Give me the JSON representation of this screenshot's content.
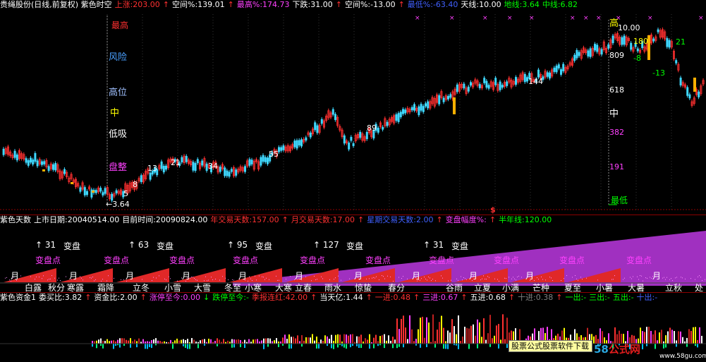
{
  "main_header": {
    "title": "贵绳股份(日线,前复权) 紫色时空",
    "items": [
      {
        "text": "上涨:203.00",
        "color": "#ff3030"
      },
      {
        "text": "↑",
        "color": "#ff3030"
      },
      {
        "text": "空间%:139.01",
        "color": "#ffffff"
      },
      {
        "text": "↑",
        "color": "#ff3030"
      },
      {
        "text": "最高%:174.73",
        "color": "#ff40ff"
      },
      {
        "text": "下跌:31.00",
        "color": "#ffffff"
      },
      {
        "text": "↑",
        "color": "#ff3030"
      },
      {
        "text": "空间%:-13.00",
        "color": "#ffffff"
      },
      {
        "text": "↑",
        "color": "#ff3030"
      },
      {
        "text": "最低%:-63.40",
        "color": "#4060ff"
      },
      {
        "text": "天线:10.00",
        "color": "#ffffff"
      },
      {
        "text": "地线:3.64",
        "color": "#00ff00"
      },
      {
        "text": "中线:6.82",
        "color": "#00ff00"
      }
    ]
  },
  "left_scale": [
    {
      "text": "最高",
      "color": "#ff3030"
    },
    {
      "text": "风险",
      "color": "#4aa0ff"
    },
    {
      "text": "高位",
      "color": "#a0c0ff"
    },
    {
      "text": "中",
      "color": "#ffff00"
    },
    {
      "text": "低吸",
      "color": "#ffffff"
    },
    {
      "text": "盘整",
      "color": "#ff40ff"
    }
  ],
  "right_scale": [
    {
      "text": "高",
      "color": "#ffff00"
    },
    {
      "text": "10.00",
      "color": "#ffffff"
    },
    {
      "text": "809",
      "color": "#ffffff"
    },
    {
      "text": "618",
      "color": "#ffffff"
    },
    {
      "text": "中",
      "color": "#ffffff"
    },
    {
      "text": "382",
      "color": "#ff40ff"
    },
    {
      "text": "191",
      "color": "#ff40ff"
    },
    {
      "text": "最低",
      "color": "#00ff00"
    }
  ],
  "fib_labels": [
    {
      "text": "5"
    },
    {
      "text": "8"
    },
    {
      "text": "13"
    },
    {
      "text": "21"
    },
    {
      "text": "34"
    },
    {
      "text": "55"
    },
    {
      "text": "89"
    },
    {
      "text": "144"
    },
    {
      "text": "180"
    },
    {
      "text": "-8"
    },
    {
      "text": "21"
    },
    {
      "text": "-13"
    }
  ],
  "low_label": "3.64",
  "dollar_mark": "$",
  "mid_header": {
    "title": "紫色天数",
    "items": [
      {
        "text": "上市日期:20040514.00",
        "color": "#ffffff"
      },
      {
        "text": "目前时间:20090824.00",
        "color": "#ffffff"
      },
      {
        "text": "年交易天数:157.00",
        "color": "#ff3030"
      },
      {
        "text": "↑",
        "color": "#ff3030"
      },
      {
        "text": "月交易天数:17.00",
        "color": "#ff3030"
      },
      {
        "text": "↑",
        "color": "#ff3030"
      },
      {
        "text": "星期交易天数:2.00",
        "color": "#4060ff"
      },
      {
        "text": "↑",
        "color": "#ff3030"
      },
      {
        "text": "变盘幅度%:",
        "color": "#ff40ff"
      },
      {
        "text": "↑",
        "color": "#ff3030"
      },
      {
        "text": "半年线:120.00",
        "color": "#00ff00"
      }
    ]
  },
  "count_labels": [
    {
      "arrow": "↑",
      "num": "31",
      "word": "变盘"
    },
    {
      "arrow": "↑",
      "num": "63",
      "word": "变盘"
    },
    {
      "arrow": "↑",
      "num": "95",
      "word": "变盘"
    },
    {
      "arrow": "↑",
      "num": "127",
      "word": "变盘"
    },
    {
      "arrow": "↑",
      "num": "31",
      "word": "变盘"
    }
  ],
  "change_points": [
    "变盘点",
    "变盘点",
    "变盘点",
    "变盘点",
    "变盘点",
    "变盘点",
    "变盘点",
    "变盘点",
    "变盘点",
    "变盘点"
  ],
  "month_labels": [
    "月",
    "月",
    "月",
    "月",
    "月",
    "月",
    "月",
    "月",
    "月",
    "月",
    "月"
  ],
  "solar_terms": [
    "白露",
    "秋分",
    "寒露",
    "霜降",
    "立冬",
    "小雪",
    "大雪",
    "冬至",
    "小寒",
    "大寒",
    "立春",
    "雨水",
    "惊蛰",
    "春分",
    "谷雨",
    "立夏",
    "小满",
    "芒种",
    "夏至",
    "小暑",
    "大暑",
    "立秋",
    "处"
  ],
  "bot_header": {
    "title": "紫色资金1",
    "items": [
      {
        "text": "委买比:3.82",
        "color": "#ffffff"
      },
      {
        "text": "↑",
        "color": "#ff3030"
      },
      {
        "text": "资金比:2.00",
        "color": "#ffffff"
      },
      {
        "text": "↑",
        "color": "#ff3030"
      },
      {
        "text": "涨停至今:0.00",
        "color": "#ff40ff"
      },
      {
        "text": "↓",
        "color": "#00ff00"
      },
      {
        "text": "跌停至今:-",
        "color": "#00ff00"
      },
      {
        "text": "季报连红:42.00",
        "color": "#ff3030"
      },
      {
        "text": "↑",
        "color": "#ff3030"
      },
      {
        "text": "当天亿:1.44",
        "color": "#ffffff"
      },
      {
        "text": "↑",
        "color": "#ff3030"
      },
      {
        "text": "一进:0.48",
        "color": "#ff3030"
      },
      {
        "text": "↑",
        "color": "#ff3030"
      },
      {
        "text": "三进:0.67",
        "color": "#ff40ff"
      },
      {
        "text": "↑",
        "color": "#ff3030"
      },
      {
        "text": "五进:0.68",
        "color": "#ffffff"
      },
      {
        "text": "↑",
        "color": "#ff3030"
      },
      {
        "text": "十进:0.38",
        "color": "#808080"
      },
      {
        "text": "↑",
        "color": "#ff3030"
      },
      {
        "text": "一出:-",
        "color": "#00ff00"
      },
      {
        "text": "三出:-",
        "color": "#00ff00"
      },
      {
        "text": "五出:-",
        "color": "#00ff00"
      },
      {
        "text": "十出:-",
        "color": "#4060ff"
      }
    ]
  },
  "tooltip": "股票公式股票软件下载",
  "brand": {
    "num": "58",
    "word": "公式网",
    "url": "www.58gu.com"
  }
}
